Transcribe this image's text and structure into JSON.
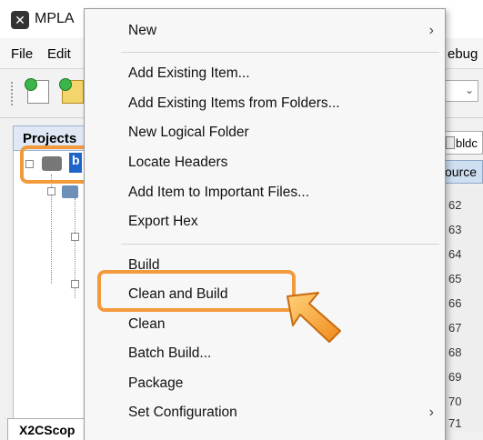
{
  "window": {
    "title": "MPLA",
    "menus": [
      "File",
      "Edit",
      "ebug"
    ]
  },
  "projects_panel": {
    "tab_label": "Projects",
    "project_label": "b"
  },
  "editor": {
    "file_tab": "bldc",
    "source_tab": "ource",
    "line_numbers": [
      "62",
      "63",
      "64",
      "65",
      "66",
      "67",
      "68",
      "69",
      "70",
      "71"
    ]
  },
  "bottom_tab": {
    "label": "X2CScop"
  },
  "context_menu": {
    "groups": [
      [
        {
          "label": "New",
          "submenu": true
        }
      ],
      [
        {
          "label": "Add Existing Item..."
        },
        {
          "label": "Add Existing Items from Folders..."
        },
        {
          "label": "New Logical Folder"
        },
        {
          "label": "Locate Headers"
        },
        {
          "label": "Add Item to Important Files..."
        },
        {
          "label": "Export Hex"
        }
      ],
      [
        {
          "label": "Build"
        },
        {
          "label": "Clean and Build",
          "highlighted": true
        },
        {
          "label": "Clean"
        },
        {
          "label": "Batch Build..."
        },
        {
          "label": "Package"
        },
        {
          "label": "Set Configuration",
          "submenu": true
        }
      ]
    ],
    "submenu_glyph": "›"
  },
  "colors": {
    "highlight": "#f39a3c",
    "menu_background": "#f7f7f7"
  }
}
